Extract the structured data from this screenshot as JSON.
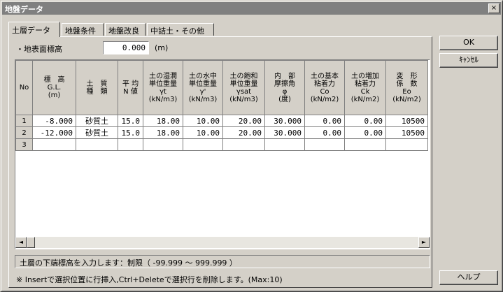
{
  "window": {
    "title": "地盤データ",
    "close_label": "×"
  },
  "tabs": [
    {
      "label": "土層データ",
      "active": true
    },
    {
      "label": "地盤条件",
      "active": false
    },
    {
      "label": "地盤改良",
      "active": false
    },
    {
      "label": "中詰土・その他",
      "active": false
    }
  ],
  "ground_elevation": {
    "label": "・地表面標高",
    "value": "0.000",
    "unit": "(m)"
  },
  "grid": {
    "headers": [
      [
        "No"
      ],
      [
        "標　高",
        "G.L.",
        "(m)"
      ],
      [
        "土　質",
        "種　類"
      ],
      [
        "平 均",
        "N 値"
      ],
      [
        "土の湿潤",
        "単位重量",
        "γt",
        "(kN/m3)"
      ],
      [
        "土の水中",
        "単位重量",
        "γ'",
        "(kN/m3)"
      ],
      [
        "土の飽和",
        "単位重量",
        "γsat",
        "(kN/m3)"
      ],
      [
        "内　部",
        "摩擦角",
        "φ",
        "(度)"
      ],
      [
        "土の基本",
        "粘着力",
        "Co",
        "(kN/m2)"
      ],
      [
        "土の増加",
        "粘着力",
        "Ck",
        "(kN/m2)"
      ],
      [
        "変　形",
        "係　数",
        "Eo",
        "(kN/m2)"
      ]
    ],
    "rows": [
      {
        "no": "1",
        "gl": "-8.000",
        "soil": "砂質土",
        "n": "15.0",
        "gt": "18.00",
        "gw": "10.00",
        "gsat": "20.00",
        "phi": "30.000",
        "co": "0.00",
        "ck": "0.00",
        "eo": "10500"
      },
      {
        "no": "2",
        "gl": "-12.000",
        "soil": "砂質土",
        "n": "15.0",
        "gt": "18.00",
        "gw": "10.00",
        "gsat": "20.00",
        "phi": "30.000",
        "co": "0.00",
        "ck": "0.00",
        "eo": "10500"
      },
      {
        "no": "3",
        "gl": "",
        "soil": "",
        "n": "",
        "gt": "",
        "gw": "",
        "gsat": "",
        "phi": "",
        "co": "",
        "ck": "",
        "eo": ""
      }
    ]
  },
  "scrollbar": {
    "left_icon": "◄",
    "right_icon": "►"
  },
  "status_text": "土層の下端標高を入力します：制限（ -99.999 ～ 999.999 ）",
  "hint_text": "※ Insertで選択位置に行挿入,Ctrl+Deleteで選択行を削除します。(Max:10)",
  "buttons": {
    "ok": "OK",
    "cancel": "ｷｬﾝｾﾙ",
    "help": "ヘルプ"
  }
}
